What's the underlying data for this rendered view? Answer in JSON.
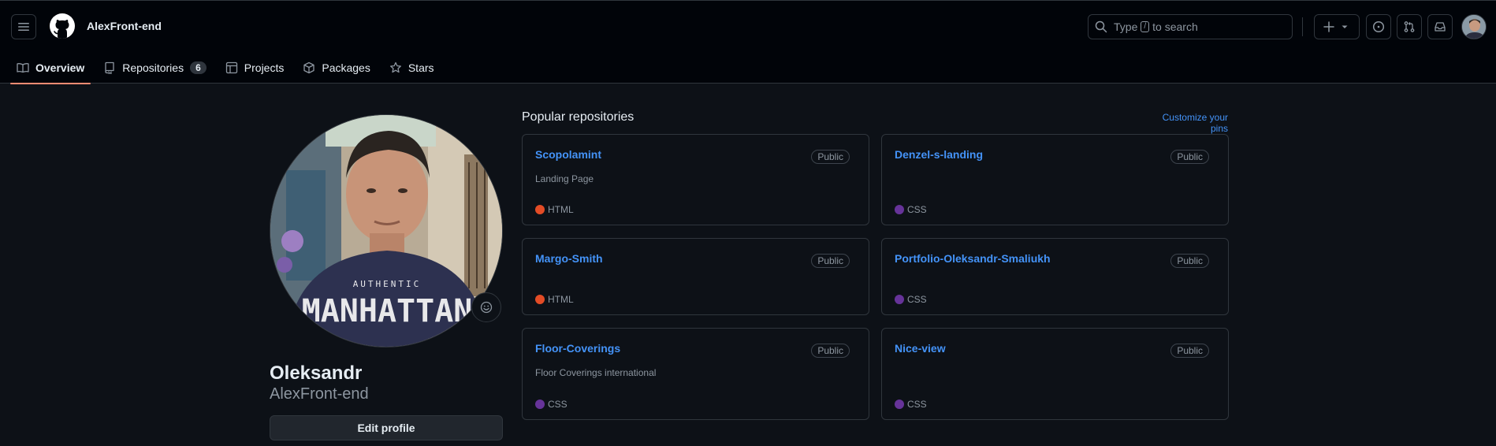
{
  "header": {
    "username": "AlexFront-end",
    "search": {
      "prefix": "Type",
      "key": "/",
      "suffix": "to search"
    }
  },
  "tabs": [
    {
      "label": "Overview",
      "icon": "book-icon"
    },
    {
      "label": "Repositories",
      "icon": "repo-icon",
      "count": "6"
    },
    {
      "label": "Projects",
      "icon": "table-icon"
    },
    {
      "label": "Packages",
      "icon": "package-icon"
    },
    {
      "label": "Stars",
      "icon": "star-icon"
    }
  ],
  "profile": {
    "full_name": "Oleksandr",
    "login": "AlexFront-end",
    "edit_label": "Edit profile",
    "shirt_text_small": "AUTHENTIC",
    "shirt_text_big": "MANHATTAN"
  },
  "popular": {
    "title": "Popular repositories",
    "customize_label": "Customize your pins",
    "repos": [
      {
        "name": "Scopolamint",
        "visibility": "Public",
        "description": "Landing Page",
        "language": "HTML",
        "lang_color": "#e34c26"
      },
      {
        "name": "Denzel-s-landing",
        "visibility": "Public",
        "description": "",
        "language": "CSS",
        "lang_color": "#663399"
      },
      {
        "name": "Margo-Smith",
        "visibility": "Public",
        "description": "",
        "language": "HTML",
        "lang_color": "#e34c26"
      },
      {
        "name": "Portfolio-Oleksandr-Smaliukh",
        "visibility": "Public",
        "description": "",
        "language": "CSS",
        "lang_color": "#663399"
      },
      {
        "name": "Floor-Coverings",
        "visibility": "Public",
        "description": "Floor Coverings international",
        "language": "CSS",
        "lang_color": "#663399"
      },
      {
        "name": "Nice-view",
        "visibility": "Public",
        "description": "",
        "language": "CSS",
        "lang_color": "#663399"
      }
    ]
  },
  "colors": {
    "accent_link": "#4493f8",
    "tab_underline": "#fd8c73",
    "background": "#0d1117"
  }
}
